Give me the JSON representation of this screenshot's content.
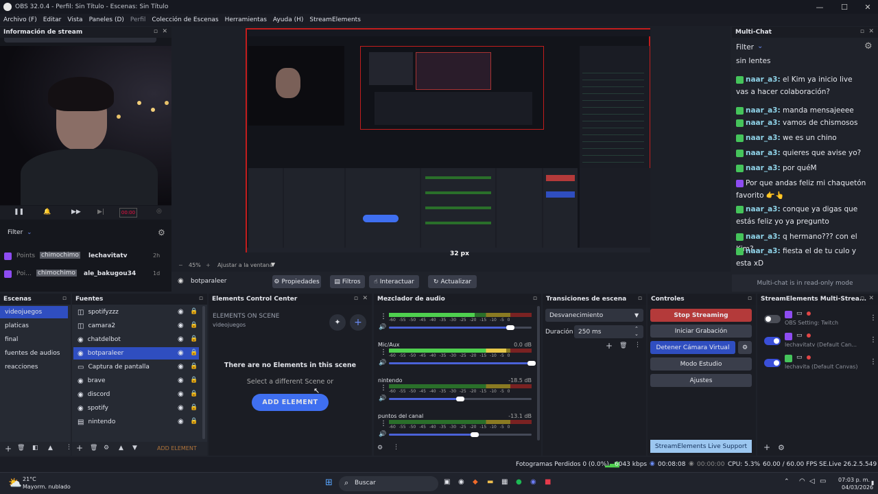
{
  "window": {
    "title": "OBS 32.0.4 - Perfil: Sin Título - Escenas: Sin Título",
    "min": "—",
    "max": "☐",
    "close": "✕"
  },
  "menu": [
    "Archivo (F)",
    "Editar",
    "Vista",
    "Paneles (D)",
    "Perfil",
    "Colección de Escenas",
    "Herramientas",
    "Ayuda (H)",
    "StreamElements"
  ],
  "stream_info": {
    "title": "Información de stream",
    "filter_label": "Filter",
    "points_rows": [
      {
        "badge": "Points",
        "tag": "chimochimo",
        "user": "lechavitatv",
        "time": "2h"
      },
      {
        "badge": "Poi...",
        "tag": "chimochimo",
        "user": "ale_bakugou34",
        "time": "1d"
      }
    ],
    "timer": "00:00"
  },
  "preview": {
    "zoom": "45%",
    "fit_label": "Ajustar a la ventana",
    "size_label": "32 px"
  },
  "source_bar": {
    "source": "botparaleer",
    "props": "Propiedades",
    "filters": "Filtros",
    "interact": "Interactuar",
    "refresh": "Actualizar"
  },
  "scenes": {
    "title": "Escenas",
    "items": [
      "videojuegos",
      "platicas",
      "final",
      "fuentes de audios",
      "reacciones"
    ],
    "selected": 0
  },
  "sources": {
    "title": "Fuentes",
    "items": [
      {
        "name": "spotifyzzz",
        "icon": "◫"
      },
      {
        "name": "camara2",
        "icon": "◫"
      },
      {
        "name": "chatdelbot",
        "icon": "◉"
      },
      {
        "name": "botparaleer",
        "icon": "◉"
      },
      {
        "name": "Captura de pantalla",
        "icon": "▭"
      },
      {
        "name": "brave",
        "icon": "◉"
      },
      {
        "name": "discord",
        "icon": "◉"
      },
      {
        "name": "spotify",
        "icon": "◉"
      },
      {
        "name": "nintendo",
        "icon": "▤"
      }
    ],
    "selected": 3,
    "add_element": "ADD ELEMENT"
  },
  "ecc": {
    "title": "Elements Control Center",
    "heading": "ELEMENTS ON SCENE",
    "scene": "videojuegos",
    "empty": "There are no Elements in this scene",
    "hint": "Select a different Scene or",
    "add": "ADD ELEMENT"
  },
  "mixer": {
    "title": "Mezclador de audio",
    "tracks": [
      {
        "name": "",
        "db": "",
        "ticks": "-60 -55 -50 -45 -40 -35 -30 -25 -20 -15 -10 -5 0",
        "level": 0.6,
        "vol": 0.85
      },
      {
        "name": "Mic/Aux",
        "db": "0.0 dB",
        "ticks": "-60 -55 -50 -45 -40 -35 -30 -25 -20 -15 -10 -5 0",
        "level": 0.82,
        "vol": 1.0
      },
      {
        "name": "nintendo",
        "db": "-18.5 dB",
        "ticks": "-60 -55 -50 -45 -40 -35 -30 -25 -20 -15 -10 -5 0",
        "level": 0,
        "vol": 0.5
      },
      {
        "name": "puntos del canal",
        "db": "-13.1 dB",
        "ticks": "-60 -55 -50 -45 -40 -35 -30 -25 -20 -15 -10 -5 0",
        "level": 0,
        "vol": 0.6
      }
    ]
  },
  "transitions": {
    "title": "Transiciones de escena",
    "type": "Desvanecimiento",
    "duration_label": "Duración",
    "duration": "250 ms"
  },
  "controls": {
    "title": "Controles",
    "stop": "Stop Streaming",
    "record": "Iniciar Grabación",
    "vcam": "Detener Cámara Virtual",
    "studio": "Modo Estudio",
    "settings": "Ajustes"
  },
  "se_multi": {
    "title": "StreamElements Multi-Strea...",
    "items": [
      {
        "name": "OBS Setting: Twitch",
        "on": false
      },
      {
        "name": "lechavitatv (Default Can...",
        "on": true
      },
      {
        "name": "lechavita (Default Canvas)",
        "on": true
      }
    ],
    "support": "StreamElements Live Support"
  },
  "multichat": {
    "title": "Multi-Chat",
    "filter": "Filter",
    "footer": "Multi-chat is in read-only mode",
    "top_line": "sin lentes",
    "messages": [
      {
        "user": "naar_a3:",
        "text": " el Kim ya inicio live vas a hacer colaboración?"
      },
      {
        "user": "naar_a3:",
        "text": " manda mensajeeee"
      },
      {
        "user": "naar_a3:",
        "text": " vamos de chismosos"
      },
      {
        "user": "naar_a3:",
        "text": " we es un chino"
      },
      {
        "user": "naar_a3:",
        "text": " quieres que avise yo?"
      },
      {
        "user": "naar_a3:",
        "text": " por quéM"
      },
      {
        "user": "",
        "text": "Por que andas feliz mi chaquetón favorito 👉👆"
      },
      {
        "user": "naar_a3:",
        "text": " conque ya digas que estás feliz yo ya pregunto"
      },
      {
        "user": "naar_a3:",
        "text": " q hermano??? con el Kim?"
      },
      {
        "user": "naar_a3:",
        "text": " fiesta el de tu culo y esta xD"
      }
    ]
  },
  "status": {
    "dropped": "Fotogramas Perdidos 0 (0.0%)",
    "kbps": "6043 kbps",
    "live": "00:08:08",
    "rec": "00:00:00",
    "cpu": "CPU: 5.3%",
    "fps": "60.00 / 60.00 FPS",
    "se": "SE.Live 26.2.5.549"
  },
  "taskbar": {
    "weather_temp": "21°C",
    "weather_desc": "Mayorm. nublado",
    "search": "Buscar",
    "time": "07:03 p. m.",
    "date": "04/03/2026"
  }
}
